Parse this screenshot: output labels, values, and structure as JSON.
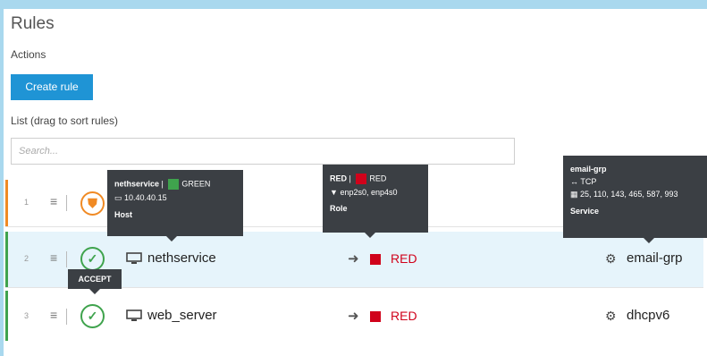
{
  "header": {
    "title": "Rules"
  },
  "actions": {
    "label": "Actions",
    "create_button": "Create rule"
  },
  "list": {
    "label": "List (drag to sort rules)",
    "search_placeholder": "Search..."
  },
  "rows": [
    {
      "number": "1",
      "action": "reject"
    },
    {
      "number": "2",
      "action": "accept",
      "source": "nethservice",
      "destination": "RED",
      "service": "email-grp"
    },
    {
      "number": "3",
      "action": "accept",
      "source": "web_server",
      "destination": "RED",
      "service": "dhcpv6"
    }
  ],
  "tooltips": {
    "host": {
      "name": "nethservice",
      "zone": "GREEN",
      "ip": "10.40.40.15",
      "type": "Host"
    },
    "role": {
      "name": "RED",
      "zone": "RED",
      "interfaces": "enp2s0, enp4s0",
      "type": "Role"
    },
    "service": {
      "name": "email-grp",
      "protocol": "TCP",
      "ports": "25, 110, 143, 465, 587, 993",
      "type": "Service"
    },
    "action": {
      "label": "ACCEPT"
    }
  },
  "colors": {
    "accent": "#1f94d5",
    "red_zone": "#d0021b",
    "green_zone": "#3fa34d",
    "warning": "#f08a24"
  }
}
